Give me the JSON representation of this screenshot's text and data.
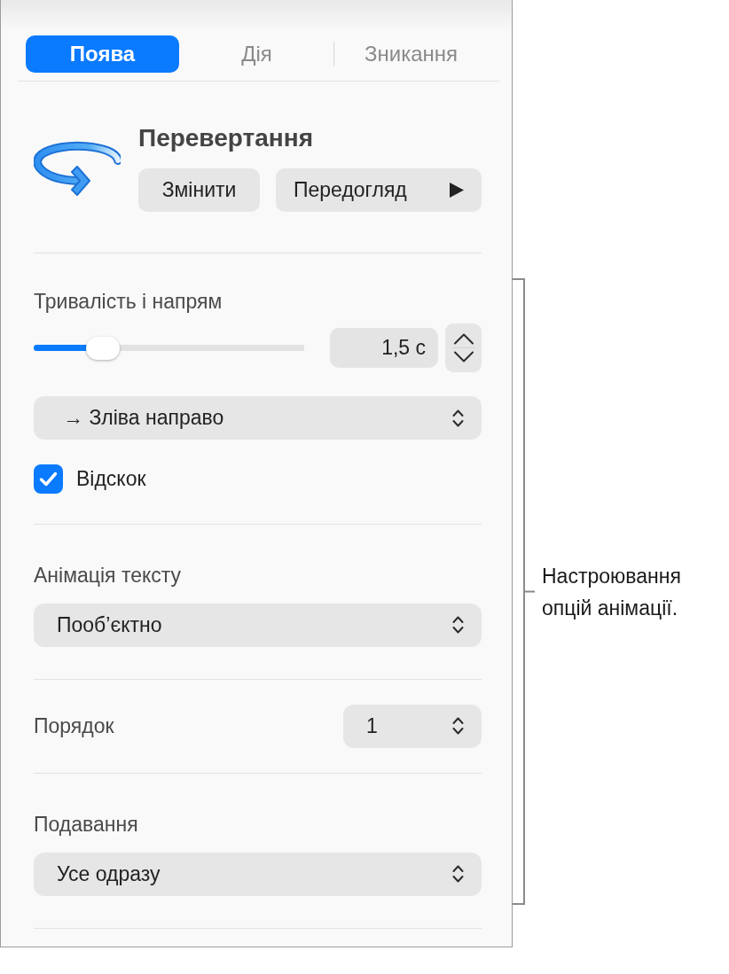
{
  "tabs": [
    {
      "label": "Поява",
      "selected": true
    },
    {
      "label": "Дія",
      "selected": false
    },
    {
      "label": "Зникання",
      "selected": false
    }
  ],
  "effect": {
    "title": "Перевертання",
    "buttons": [
      {
        "label": "Змінити",
        "kind": "plain"
      },
      {
        "label": "Передогляд",
        "kind": "play"
      }
    ]
  },
  "duration": {
    "label": "Тривалість і напрям",
    "slider": {
      "level": 0.22
    },
    "value": "1,5 с",
    "direction": "→ Зліва направо",
    "bounce": {
      "label": "Відскок",
      "checked": true
    }
  },
  "text_animation": {
    "label": "Анімація тексту",
    "value": "Пооб’єктно"
  },
  "order": {
    "label": "Порядок",
    "value": "1"
  },
  "delivery": {
    "label": "Подавання",
    "value": "Усе одразу"
  },
  "callout": {
    "text": "Настроювання опцій анімації."
  }
}
